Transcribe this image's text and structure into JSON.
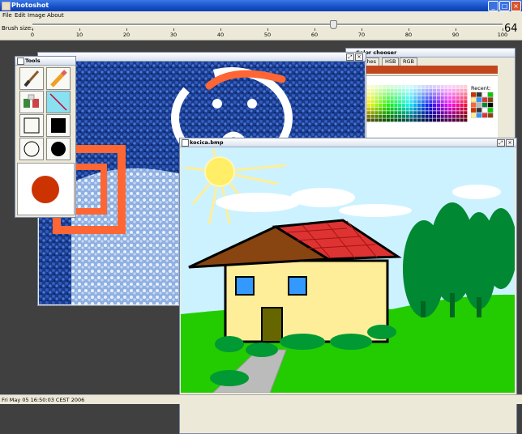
{
  "app": {
    "title": "Photoshot"
  },
  "menu": [
    "File",
    "Edit",
    "Image",
    "About"
  ],
  "brush": {
    "label": "Brush size:",
    "value": "64",
    "ticks": [
      "0",
      "10",
      "20",
      "30",
      "40",
      "50",
      "60",
      "70",
      "80",
      "90",
      "100"
    ],
    "level": 64
  },
  "color_chooser": {
    "title": "Color chooser",
    "tabs": [
      "Swatches",
      "HSB",
      "RGB"
    ],
    "recent_label": "Recent:",
    "selected_color": "#c2461c"
  },
  "tools": {
    "title": "Tools",
    "current_color": "#cc3300"
  },
  "kocica": {
    "title": "kocica.bmp"
  },
  "status": {
    "text": "Fri May 05 16:50:03 CEST 2006"
  },
  "colors": {
    "accent": "#c2461c",
    "desktop": "#404040",
    "sky": "#cceeff",
    "grass": "#22cc00",
    "roof": "#dd3333",
    "wall": "#ffee99"
  }
}
